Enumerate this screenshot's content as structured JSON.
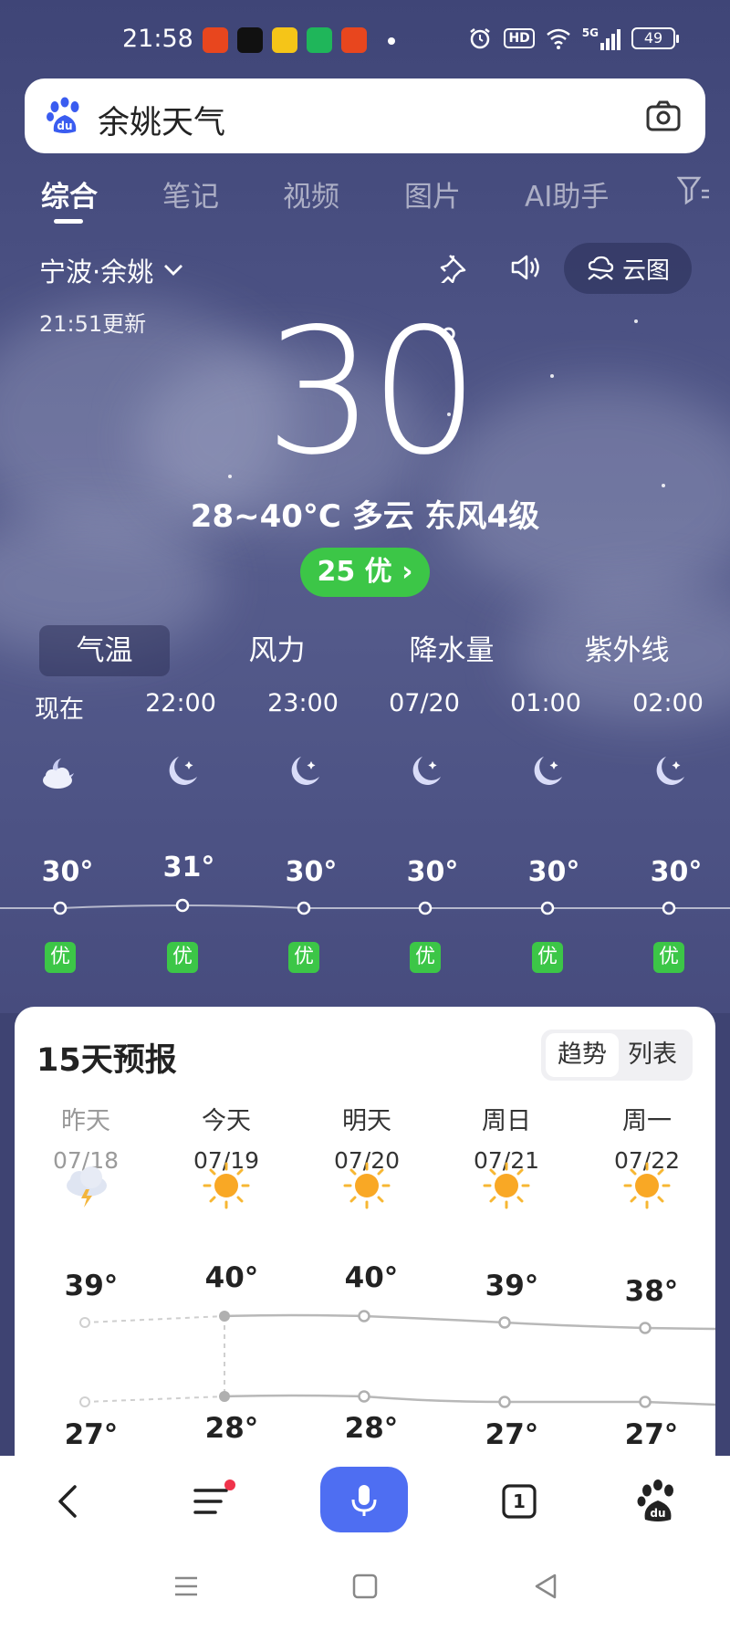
{
  "status_bar": {
    "time": "21:58",
    "battery": "49",
    "network": "5G",
    "hd": "HD"
  },
  "search": {
    "query": "余姚天气"
  },
  "tabs": [
    {
      "label": "综合",
      "active": true
    },
    {
      "label": "笔记"
    },
    {
      "label": "视频"
    },
    {
      "label": "图片"
    },
    {
      "label": "AI助手"
    }
  ],
  "weather": {
    "location": "宁波·余姚",
    "updated": "21:51更新",
    "current_temp": "30",
    "degree_symbol": "°",
    "summary": "28~40°C 多云 东风4级",
    "aqi": "25 优",
    "cloud_map_label": "云图"
  },
  "metric_tabs": [
    "气温",
    "风力",
    "降水量",
    "紫外线"
  ],
  "hourly": [
    {
      "time": "现在",
      "icon": "cloudy-night-icon",
      "temp": "30°",
      "aq": "优"
    },
    {
      "time": "22:00",
      "icon": "moon-icon",
      "temp": "31°",
      "aq": "优"
    },
    {
      "time": "23:00",
      "icon": "moon-icon",
      "temp": "30°",
      "aq": "优"
    },
    {
      "time": "07/20",
      "icon": "moon-icon",
      "temp": "30°",
      "aq": "优"
    },
    {
      "time": "01:00",
      "icon": "moon-icon",
      "temp": "30°",
      "aq": "优"
    },
    {
      "time": "02:00",
      "icon": "moon-icon",
      "temp": "30°",
      "aq": "优"
    }
  ],
  "forecast": {
    "title": "15天预报",
    "view_options": [
      "趋势",
      "列表"
    ],
    "days": [
      {
        "name": "昨天",
        "date": "07/18",
        "icon": "thunderstorm-icon",
        "high": "39°",
        "low": "27°",
        "past": true
      },
      {
        "name": "今天",
        "date": "07/19",
        "icon": "sun-icon",
        "high": "40°",
        "low": "28°"
      },
      {
        "name": "明天",
        "date": "07/20",
        "icon": "sun-icon",
        "high": "40°",
        "low": "28°"
      },
      {
        "name": "周日",
        "date": "07/21",
        "icon": "sun-icon",
        "high": "39°",
        "low": "27°"
      },
      {
        "name": "周一",
        "date": "07/22",
        "icon": "sun-icon",
        "high": "38°",
        "low": "27°"
      }
    ]
  },
  "bottom_nav": {
    "tab_count": "1"
  },
  "colors": {
    "aqi_green": "#3cc647",
    "accent_blue": "#4e6ef2",
    "sky": "#4b5183"
  }
}
